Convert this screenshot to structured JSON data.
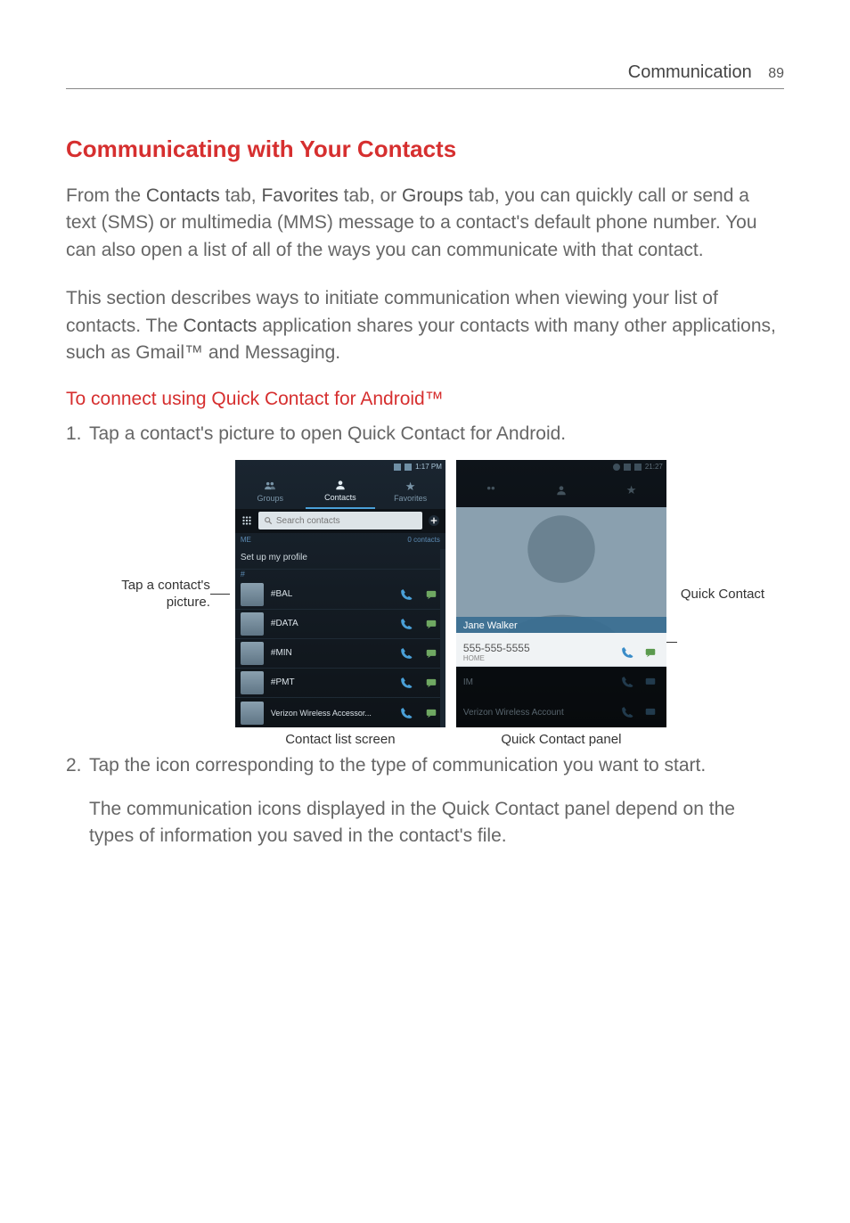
{
  "header": {
    "section": "Communication",
    "page_number": "89"
  },
  "h2": "Communicating with Your Contacts",
  "para1": {
    "pre": "From the ",
    "b1": "Contacts",
    "mid1": " tab, ",
    "b2": "Favorites",
    "mid2": " tab, or ",
    "b3": "Groups",
    "post": " tab, you can quickly call or send a text (SMS) or multimedia (MMS) message to a contact's default phone number. You can also open a list of all of the ways you can communicate with that contact."
  },
  "para2": {
    "pre": "This section describes ways to initiate communication when viewing your list of contacts. The ",
    "b1": "Contacts",
    "post": " application shares your contacts with many other applications, such as Gmail™ and Messaging."
  },
  "h3": "To connect using Quick Contact for Android™",
  "step1": {
    "num": "1.",
    "text": "Tap a contact's picture to open Quick Contact for Android."
  },
  "figure": {
    "left_caption_l1": "Tap a contact's",
    "left_caption_l2": "picture.",
    "right_caption": "Quick Contact",
    "caption_a": "Contact list screen",
    "caption_b": "Quick Contact panel"
  },
  "phoneA": {
    "status_time": "1:17 PM",
    "tabs": {
      "groups": "Groups",
      "contacts": "Contacts",
      "favorites": "Favorites"
    },
    "search_placeholder": "Search contacts",
    "me_label": "ME",
    "me_count": "0 contacts",
    "profile": "Set up my profile",
    "letter": "#",
    "rows": [
      "#BAL",
      "#DATA",
      "#MIN",
      "#PMT",
      "Verizon Wireless Accessor..."
    ]
  },
  "phoneB": {
    "status_time": "21:27",
    "contact_name": "Jane Walker",
    "phone_number": "555-555-5555",
    "phone_type": "HOME",
    "row2_label": "IM",
    "row3_label": "Verizon Wireless Account"
  },
  "step2": {
    "num": "2.",
    "text": "Tap the icon corresponding to the type of communication you want to start."
  },
  "step2_note": "The communication icons displayed in the Quick Contact panel depend on the types of information you saved in the contact's file."
}
